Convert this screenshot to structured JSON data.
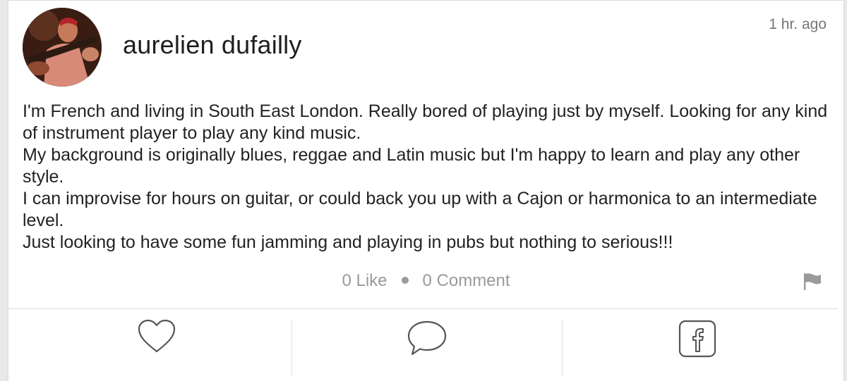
{
  "post": {
    "author": "aurelien dufailly",
    "timestamp": "1 hr. ago",
    "body": [
      "I'm French and living in South East London. Really bored of playing just by myself. Looking for any kind of instrument player to play any kind music.",
      "My background is originally blues, reggae and Latin music but I'm happy to learn and play any other style.",
      "I can improvise for hours on guitar, or could back you up with a Cajon or harmonica to an intermediate level.",
      "Just looking to have some fun jamming and playing in pubs but nothing to serious!!!"
    ],
    "likes_label": "0 Like",
    "comments_label": "0 Comment"
  },
  "icons": {
    "avatar": "avatar-photo",
    "flag": "flag-icon",
    "like": "heart-icon",
    "comment": "speech-bubble-icon",
    "share": "facebook-icon"
  },
  "colors": {
    "text": "#222222",
    "muted": "#9a9a9a",
    "icon_stroke": "#555555",
    "divider": "#dcdcdc"
  }
}
